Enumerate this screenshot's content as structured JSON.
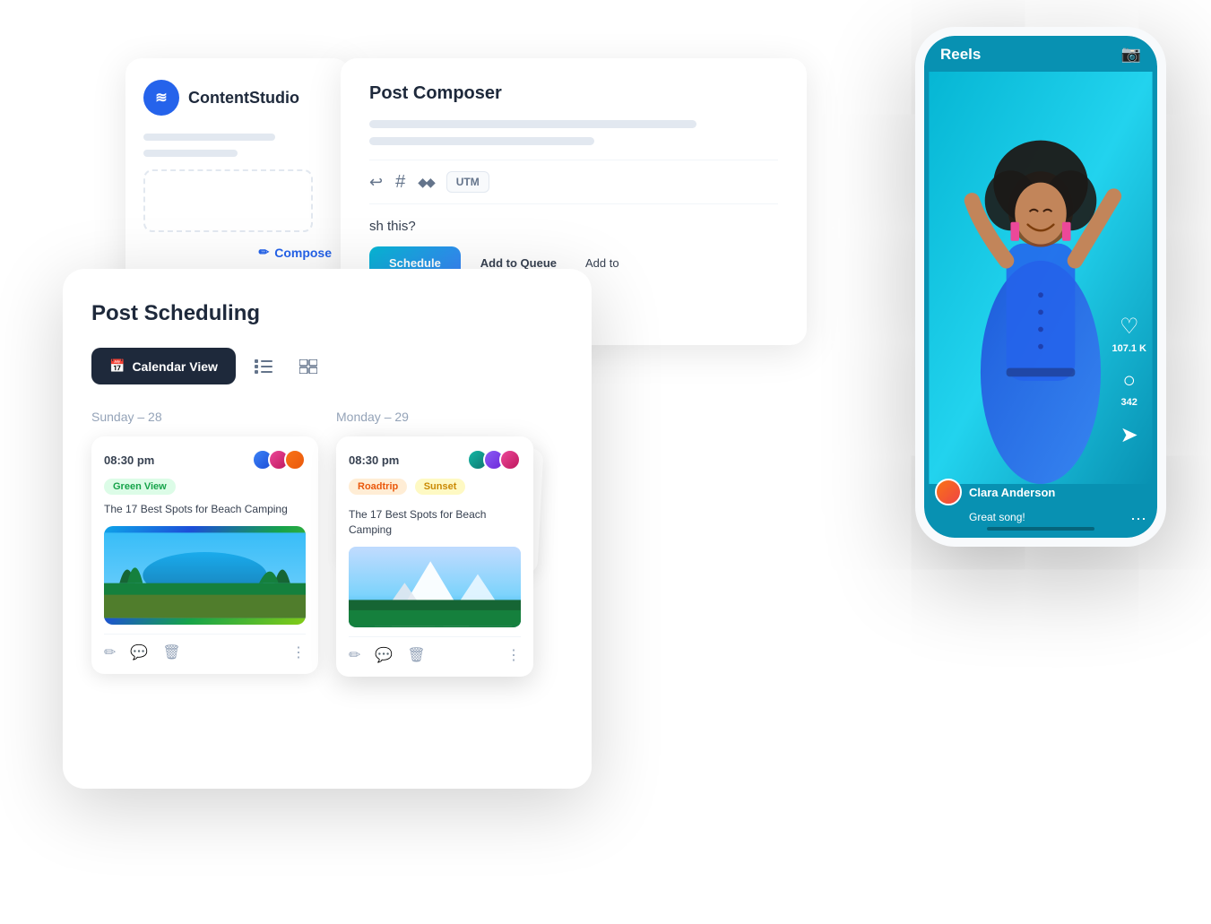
{
  "app": {
    "brand": "ContentStudio",
    "logo_symbol": "≋"
  },
  "sidebar_card": {
    "compose_label": "Compose",
    "compose_icon": "✏"
  },
  "post_composer_card": {
    "title": "Post Composer",
    "toolbar_icons": [
      "↩",
      "#",
      "◆◆",
      "UTM"
    ],
    "schedule_question": "sh this?",
    "buttons": {
      "schedule": "Schedule",
      "add_to_queue": "Add to Queue",
      "add_more": "Add to"
    }
  },
  "scheduling_card": {
    "title": "Post Scheduling",
    "calendar_view_label": "Calendar View",
    "calendar_icon": "📅",
    "days": [
      {
        "label": "Sunday – 28",
        "posts": [
          {
            "time": "08:30 pm",
            "tag": "Green View",
            "tag_color": "green",
            "text": "The 17 Best Spots for Beach Camping",
            "image_type": "beach"
          }
        ]
      },
      {
        "label": "Monday – 29",
        "posts": [
          {
            "time": "08:30 pm",
            "tags": [
              "Roadtrip",
              "Sunset"
            ],
            "tag_colors": [
              "orange",
              "yellow"
            ],
            "text": "The 17 Best Spots for Beach Camping",
            "image_type": "mountain"
          }
        ]
      }
    ]
  },
  "phone": {
    "section_label": "Reels",
    "user": {
      "name": "Clara Anderson",
      "comment": "Great song!"
    },
    "stats": {
      "likes": "107.1 K",
      "comments": "342"
    }
  }
}
